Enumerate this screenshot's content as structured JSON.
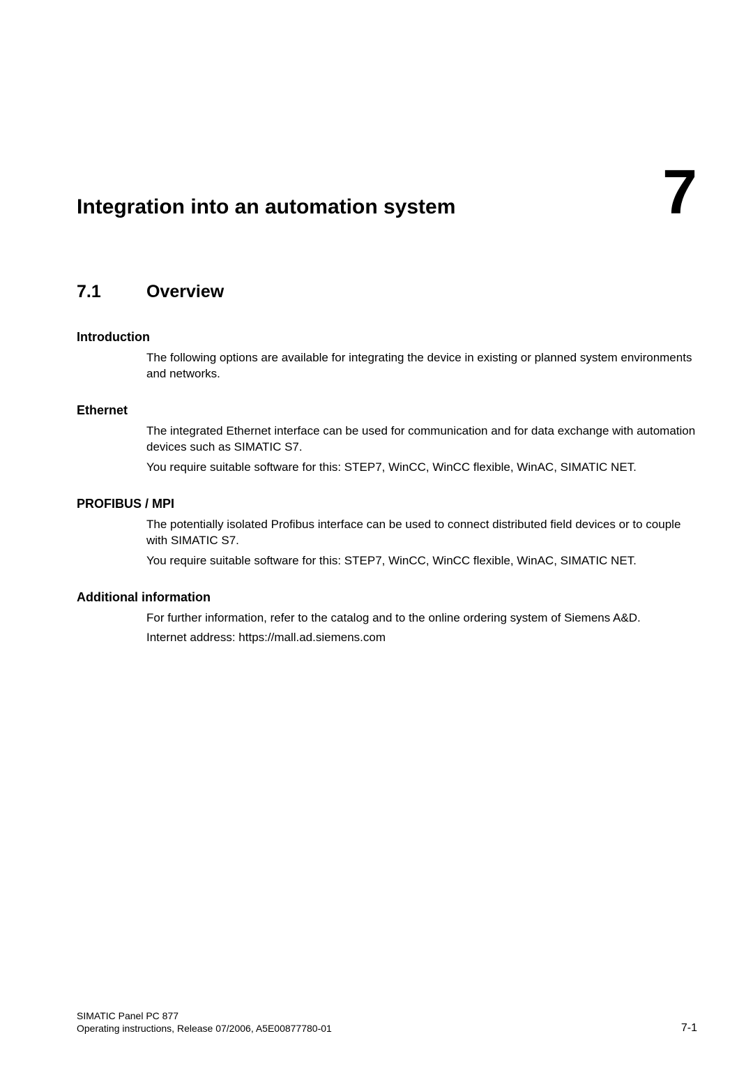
{
  "chapter": {
    "title": "Integration into an automation system",
    "number": "7"
  },
  "section": {
    "number": "7.1",
    "title": "Overview"
  },
  "subsections": {
    "introduction": {
      "title": "Introduction",
      "p1": "The following options are available for integrating the device in existing or planned system environments and networks."
    },
    "ethernet": {
      "title": "Ethernet",
      "p1": "The integrated Ethernet interface can be used for communication and for data exchange with automation devices such as SIMATIC S7.",
      "p2": "You require suitable software for this: STEP7, WinCC, WinCC flexible, WinAC, SIMATIC NET."
    },
    "profibus": {
      "title": "PROFIBUS / MPI",
      "p1": "The potentially isolated Profibus interface can be used to connect distributed field devices or to couple with SIMATIC S7.",
      "p2": "You require suitable software for this: STEP7, WinCC, WinCC flexible, WinAC, SIMATIC NET."
    },
    "additional": {
      "title": "Additional information",
      "p1": "For further information, refer to the catalog and to the online ordering system of Siemens A&D.",
      "p2": "Internet address: https://mall.ad.siemens.com"
    }
  },
  "footer": {
    "product": "SIMATIC Panel PC 877",
    "release": "Operating instructions, Release 07/2006, A5E00877780-01",
    "page": "7-1"
  }
}
